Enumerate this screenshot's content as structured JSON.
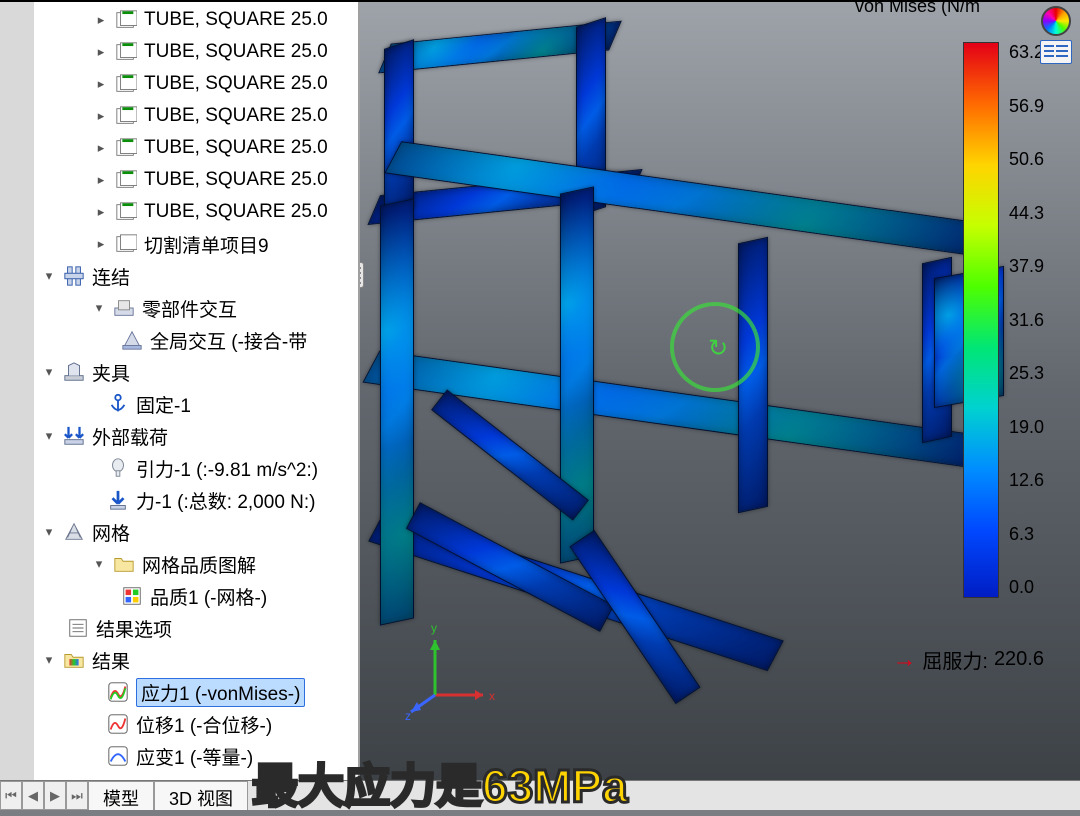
{
  "tree": {
    "tubes": [
      "TUBE, SQUARE 25.0",
      "TUBE, SQUARE 25.0",
      "TUBE, SQUARE 25.0",
      "TUBE, SQUARE 25.0",
      "TUBE, SQUARE 25.0",
      "TUBE, SQUARE 25.0",
      "TUBE, SQUARE 25.0"
    ],
    "cutlist": "切割清单项目9",
    "connections": {
      "label": "连结",
      "component_contact": "零部件交互",
      "global_contact": "全局交互 (-接合-带"
    },
    "fixtures": {
      "label": "夹具",
      "fixed": "固定-1"
    },
    "loads": {
      "label": "外部载荷",
      "gravity": "引力-1 (:-9.81 m/s^2:)",
      "force": "力-1 (:总数: 2,000 N:)"
    },
    "mesh": {
      "label": "网格",
      "quality_plot": "网格品质图解",
      "quality_item": "品质1 (-网格-)"
    },
    "result_options": "结果选项",
    "results": {
      "label": "结果",
      "stress": "应力1 (-vonMises-)",
      "displacement": "位移1 (-合位移-)",
      "strain": "应变1 (-等量-)"
    }
  },
  "legend": {
    "title": "von Mises (N/m",
    "values": [
      "63.2",
      "56.9",
      "50.6",
      "44.3",
      "37.9",
      "31.6",
      "25.3",
      "19.0",
      "12.6",
      "6.3",
      "0.0"
    ],
    "yield_label": "屈服力:",
    "yield_value": "220.6"
  },
  "tabs": {
    "model": "模型",
    "view3d": "3D 视图"
  },
  "caption": "最大应力是63MPa"
}
